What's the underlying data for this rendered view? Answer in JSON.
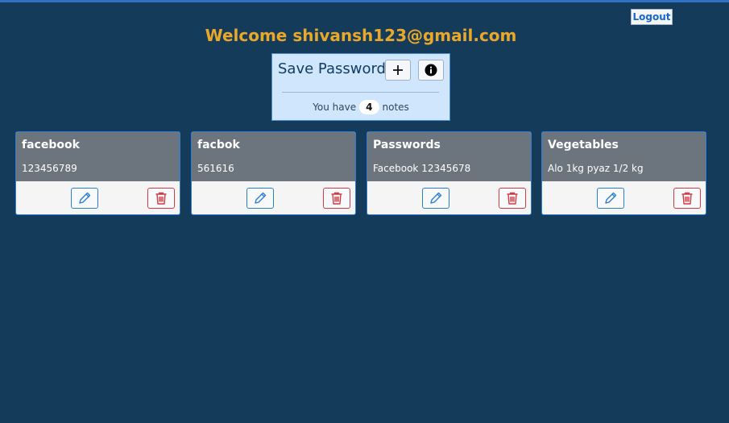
{
  "header": {
    "logout_label": "Logout",
    "welcome_text": "Welcome shivansh123@gmail.com"
  },
  "save_panel": {
    "title": "Save Password",
    "add_icon": "plus-icon",
    "info_icon": "info-icon",
    "notes_prefix": "You have",
    "notes_count": "4",
    "notes_suffix": "notes"
  },
  "notes": [
    {
      "title": "facebook",
      "content": "123456789"
    },
    {
      "title": "facbok",
      "content": "561616"
    },
    {
      "title": "Passwords",
      "content": "Facebook 12345678"
    },
    {
      "title": "Vegetables",
      "content": "Alo 1kg pyaz 1/2 kg"
    }
  ],
  "colors": {
    "background": "#153b5a",
    "welcome": "#eaa82a",
    "card_header": "#6c757d",
    "edit_accent": "#2a7fd4",
    "delete_accent": "#d43a45"
  }
}
